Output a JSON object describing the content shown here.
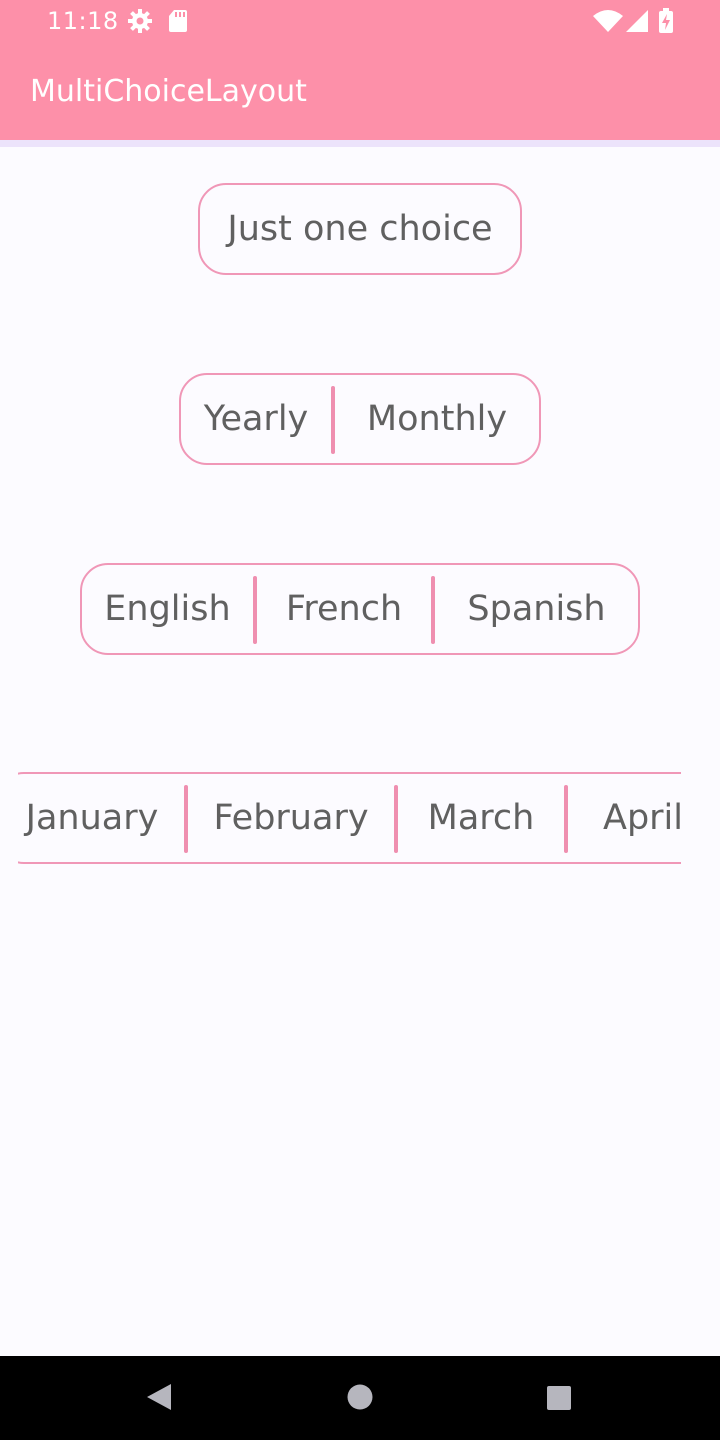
{
  "status_bar": {
    "time": "11:18",
    "icons": [
      "settings-icon",
      "sd-card-icon",
      "wifi-icon",
      "signal-icon",
      "battery-charging-icon"
    ]
  },
  "app_bar": {
    "title": "MultiChoiceLayout"
  },
  "groups": {
    "single": {
      "options": [
        "Just one choice"
      ]
    },
    "plan": {
      "options": [
        "Yearly",
        "Monthly"
      ]
    },
    "language": {
      "options": [
        "English",
        "French",
        "Spanish"
      ]
    },
    "months": {
      "options": [
        "January",
        "February",
        "March",
        "April"
      ]
    }
  },
  "colors": {
    "app_bar": "#fd90a9",
    "outline": "#f097b7",
    "text": "#606060",
    "background": "#fcfbff"
  },
  "nav_bar": {
    "buttons": [
      "back-icon",
      "home-icon",
      "recents-icon"
    ]
  }
}
